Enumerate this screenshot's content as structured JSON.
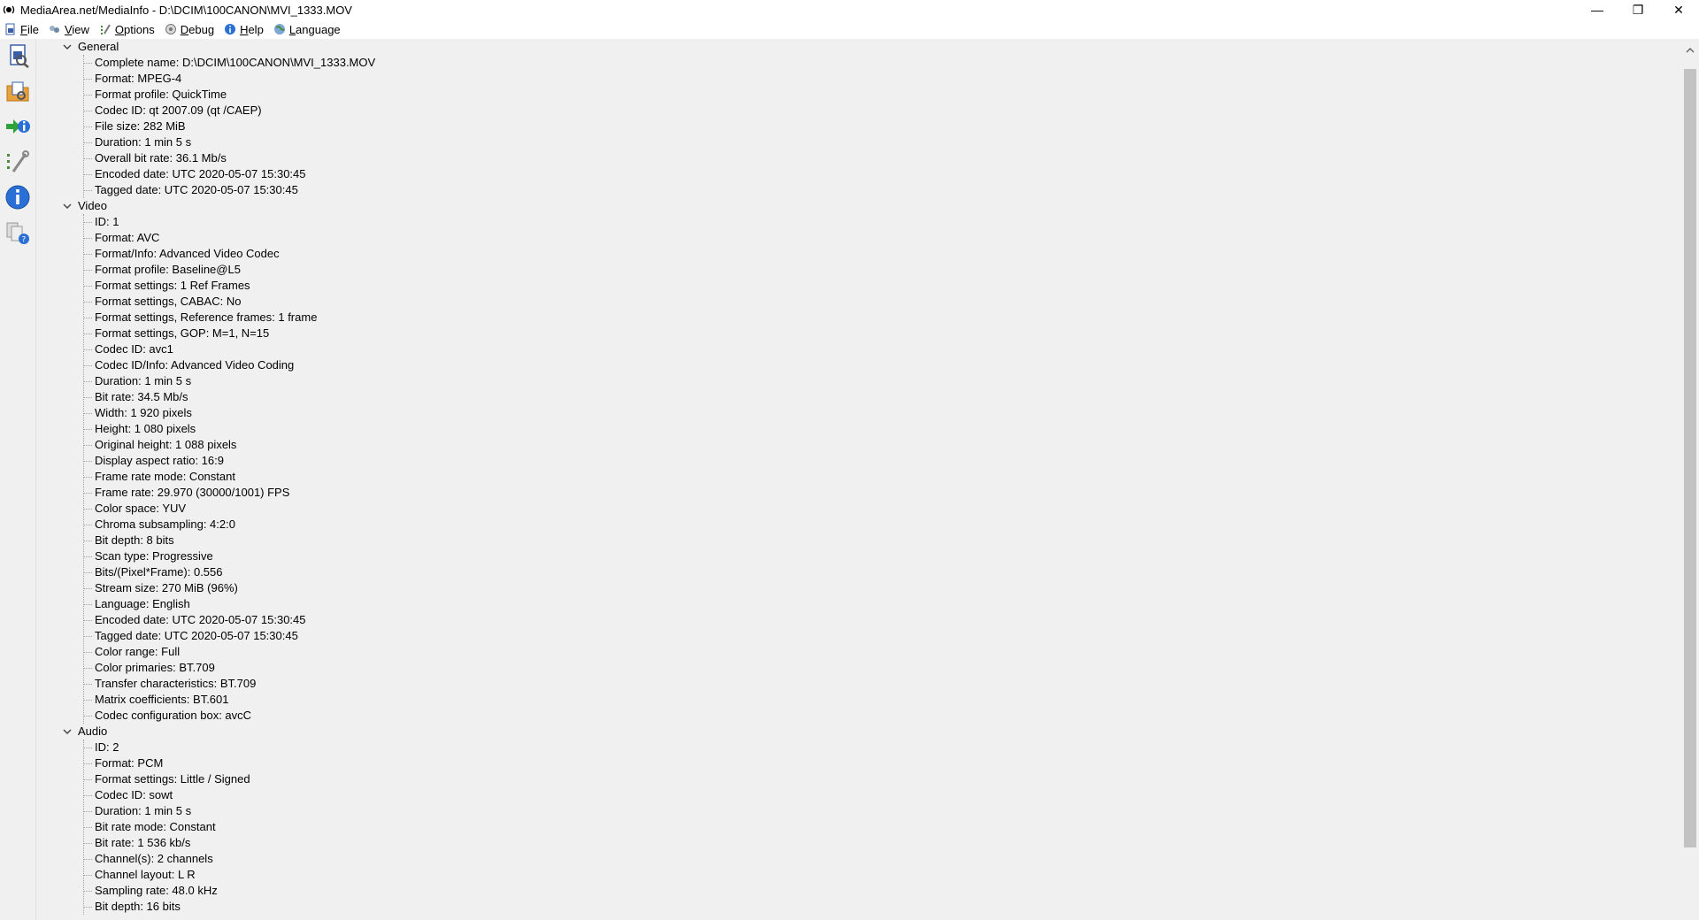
{
  "window": {
    "title": "MediaArea.net/MediaInfo - D:\\DCIM\\100CANON\\MVI_1333.MOV",
    "controls": {
      "minimize": "—",
      "restore": "❐",
      "close": "✕"
    }
  },
  "menu": [
    {
      "label": "File",
      "icon": "file-icon"
    },
    {
      "label": "View",
      "icon": "view-icon"
    },
    {
      "label": "Options",
      "icon": "options-icon"
    },
    {
      "label": "Debug",
      "icon": "debug-icon"
    },
    {
      "label": "Help",
      "icon": "help-icon"
    },
    {
      "label": "Language",
      "icon": "language-icon"
    }
  ],
  "toolbar": [
    {
      "icon": "open-file-icon"
    },
    {
      "icon": "open-folder-icon"
    },
    {
      "icon": "export-icon"
    },
    {
      "icon": "preferences-icon"
    },
    {
      "icon": "about-icon"
    },
    {
      "icon": "knowledge-icon"
    }
  ],
  "sections": [
    {
      "name": "General",
      "items": [
        "Complete name: D:\\DCIM\\100CANON\\MVI_1333.MOV",
        "Format: MPEG-4",
        "Format profile: QuickTime",
        "Codec ID: qt   2007.09 (qt  /CAEP)",
        "File size: 282 MiB",
        "Duration: 1 min 5 s",
        "Overall bit rate: 36.1 Mb/s",
        "Encoded date: UTC 2020-05-07 15:30:45",
        "Tagged date: UTC 2020-05-07 15:30:45"
      ]
    },
    {
      "name": "Video",
      "items": [
        "ID: 1",
        "Format: AVC",
        "Format/Info: Advanced Video Codec",
        "Format profile: Baseline@L5",
        "Format settings: 1 Ref Frames",
        "Format settings, CABAC: No",
        "Format settings, Reference frames: 1 frame",
        "Format settings, GOP: M=1, N=15",
        "Codec ID: avc1",
        "Codec ID/Info: Advanced Video Coding",
        "Duration: 1 min 5 s",
        "Bit rate: 34.5 Mb/s",
        "Width: 1 920 pixels",
        "Height: 1 080 pixels",
        "Original height: 1 088 pixels",
        "Display aspect ratio: 16:9",
        "Frame rate mode: Constant",
        "Frame rate: 29.970 (30000/1001) FPS",
        "Color space: YUV",
        "Chroma subsampling: 4:2:0",
        "Bit depth: 8 bits",
        "Scan type: Progressive",
        "Bits/(Pixel*Frame): 0.556",
        "Stream size: 270 MiB (96%)",
        "Language: English",
        "Encoded date: UTC 2020-05-07 15:30:45",
        "Tagged date: UTC 2020-05-07 15:30:45",
        "Color range: Full",
        "Color primaries: BT.709",
        "Transfer characteristics: BT.709",
        "Matrix coefficients: BT.601",
        "Codec configuration box: avcC"
      ]
    },
    {
      "name": "Audio",
      "items": [
        "ID: 2",
        "Format: PCM",
        "Format settings: Little / Signed",
        "Codec ID: sowt",
        "Duration: 1 min 5 s",
        "Bit rate mode: Constant",
        "Bit rate: 1 536 kb/s",
        "Channel(s): 2 channels",
        "Channel layout: L R",
        "Sampling rate: 48.0 kHz",
        "Bit depth: 16 bits"
      ]
    }
  ]
}
